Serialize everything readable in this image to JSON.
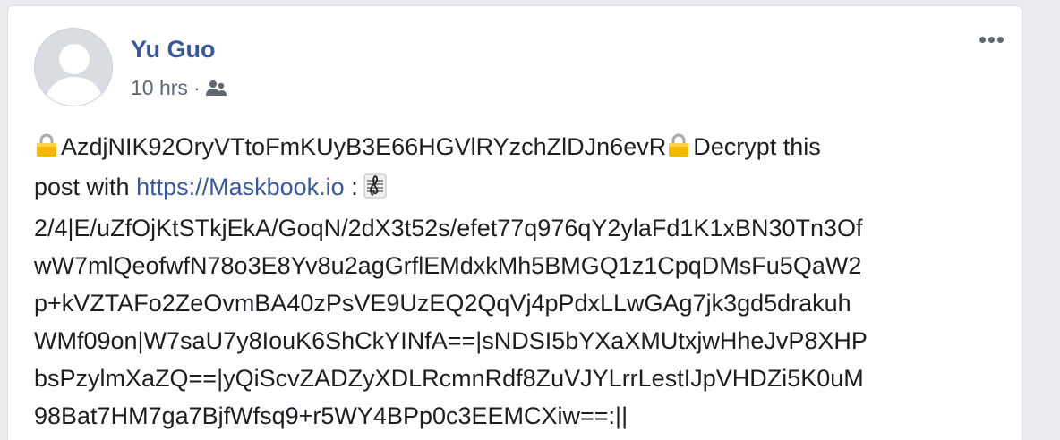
{
  "post": {
    "author": "Yu Guo",
    "time": "10 hrs",
    "separator": "·",
    "audience_icon": "friends-icon",
    "more_icon": "more-options-icon",
    "body": {
      "cipher_head": "AzdjNIK92OryVTtoFmKUyB3E66HGVlRYzchZlDJn6evR",
      "decrypt_text": "Decrypt this",
      "line2_prefix": "post with ",
      "link": "https://Maskbook.io",
      "line2_suffix": " :",
      "lines": [
        "2/4|E/uZfOjKtSTkjEkA/GoqN/2dX3t52s/efet77q976qY2ylaFd1K1xBN30Tn3Of",
        "wW7mlQeofwfN78o3E8Yv8u2agGrflEMdxkMh5BMGQ1z1CpqDMsFu5QaW2",
        "p+kVZTAFo2ZeOvmBA40zPsVE9UzEQ2QqVj4pPdxLLwGAg7jk3gd5drakuh",
        "WMf09on|W7saU7y8IouK6ShCkYINfA==|sNDSI5bYXaXMUtxjwHheJvP8XHP",
        "bsPzylmXaZQ==|yQiScvZADZyXDLRcmnRdf8ZuVJYLrrLestIJpVHDZi5K0uM",
        "98Bat7HM7ga7BjfWfsq9+r5WY4BPp0c3EEMCXiw==:||"
      ],
      "lock_icon": "lock-icon",
      "clef_icon": "music-score-icon"
    }
  },
  "colors": {
    "link": "#385898",
    "text": "#1c1e21",
    "meta": "#606770"
  }
}
